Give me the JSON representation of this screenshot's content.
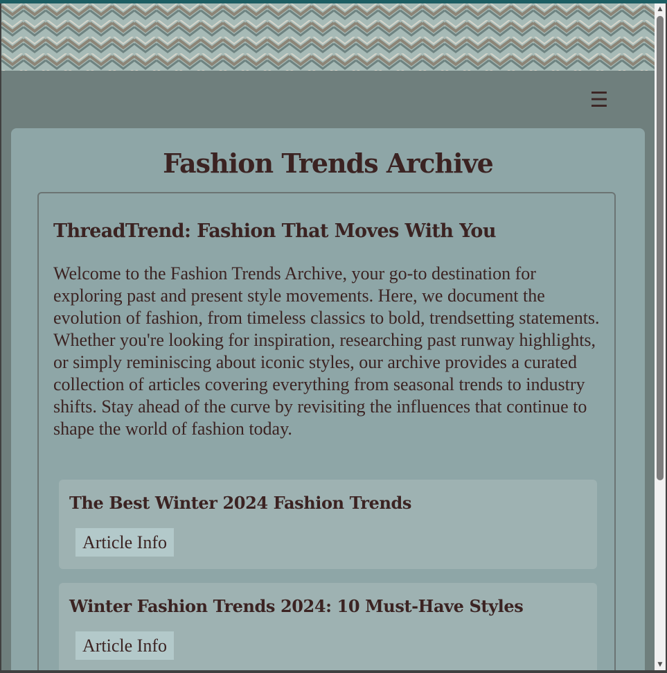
{
  "header": {
    "menu_icon": "hamburger-menu-icon",
    "menu_glyph": "☰"
  },
  "page": {
    "title": "Fashion Trends Archive"
  },
  "intro": {
    "heading": "ThreadTrend: Fashion That Moves With You",
    "text": "Welcome to the Fashion Trends Archive, your go-to destination for exploring past and present style movements. Here, we document the evolution of fashion, from timeless classics to bold, trendsetting statements. Whether you're looking for inspiration, researching past runway highlights, or simply reminiscing about iconic styles, our archive provides a curated collection of articles covering everything from seasonal trends to industry shifts. Stay ahead of the curve by revisiting the influences that continue to shape the world of fashion today."
  },
  "articles": [
    {
      "title": "The Best Winter 2024 Fashion Trends",
      "button_label": "Article Info"
    },
    {
      "title": "Winter Fashion Trends 2024: 10 Must-Have Styles",
      "button_label": "Article Info"
    }
  ],
  "scrollbar": {
    "up_glyph": "▲",
    "down_glyph": "▼"
  },
  "colors": {
    "accent_top": "#1d5e63",
    "header_bg": "#6f7f7d",
    "card_bg": "#8ea6a7",
    "article_bg": "#9eb2b2",
    "button_bg": "#b3c9ca",
    "text": "#3b2322"
  }
}
